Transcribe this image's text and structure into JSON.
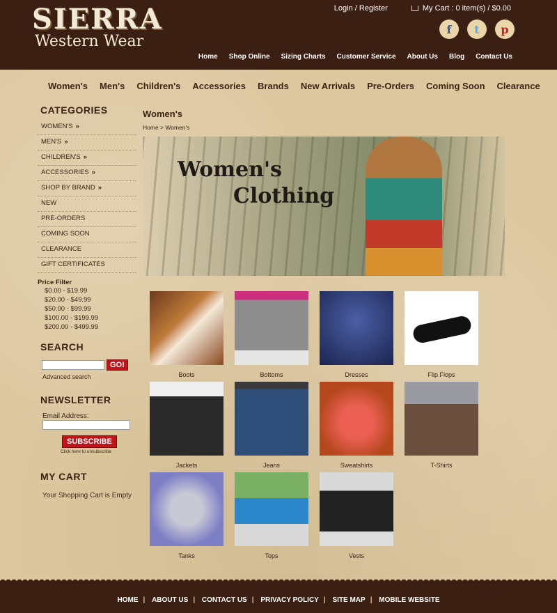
{
  "header": {
    "logo_line1": "SIERRA",
    "logo_line2": "Western Wear",
    "login": "Login / Register",
    "cart": "My Cart : 0 item(s) / $0.00",
    "social": [
      "f",
      "t",
      "p"
    ],
    "top_nav": [
      "Home",
      "Shop Online",
      "Sizing Charts",
      "Customer Service",
      "About Us",
      "Blog",
      "Contact Us"
    ]
  },
  "main_nav": [
    "Women's",
    "Men's",
    "Children's",
    "Accessories",
    "Brands",
    "New Arrivals",
    "Pre-Orders",
    "Coming Soon",
    "Clearance"
  ],
  "sidebar": {
    "categories_title": "CATEGORIES",
    "categories": [
      {
        "label": "WOMEN'S",
        "arrow": "»"
      },
      {
        "label": "MEN'S",
        "arrow": "»"
      },
      {
        "label": "CHILDREN'S",
        "arrow": "»"
      },
      {
        "label": "ACCESSORIES",
        "arrow": "»"
      },
      {
        "label": "SHOP BY BRAND",
        "arrow": "»"
      },
      {
        "label": "NEW",
        "arrow": ""
      },
      {
        "label": "PRE-ORDERS",
        "arrow": ""
      },
      {
        "label": "COMING SOON",
        "arrow": ""
      },
      {
        "label": "CLEARANCE",
        "arrow": ""
      },
      {
        "label": "GIFT CERTIFICATES",
        "arrow": ""
      }
    ],
    "price_title": "Price Filter",
    "prices": [
      "$0.00 - $19.99",
      "$20.00 - $49.99",
      "$50.00 - $99.99",
      "$100.00 - $199.99",
      "$200.00 - $499.99"
    ],
    "search_title": "SEARCH",
    "go_label": "GO!",
    "advanced": "Advanced search",
    "newsletter_title": "NEWSLETTER",
    "email_label": "Email Address:",
    "subscribe": "SUBSCRIBE",
    "unsubscribe": "Click here to unsubscribe",
    "mycart_title": "MY CART",
    "cart_empty": "Your Shopping Cart is Empty"
  },
  "content": {
    "title": "Women's",
    "breadcrumb": "Home > Women's",
    "banner_line1": "Women's",
    "banner_line2": "Clothing",
    "tiles": [
      "Boots",
      "Bottoms",
      "Dresses",
      "Flip Flops",
      "Jackets",
      "Jeans",
      "Sweatshirts",
      "T-Shirts",
      "Tanks",
      "Tops",
      "Vests"
    ]
  },
  "footer": [
    "HOME",
    "ABOUT US",
    "CONTACT US",
    "PRIVACY POLICY",
    "SITE MAP",
    "MOBILE WEBSITE"
  ]
}
